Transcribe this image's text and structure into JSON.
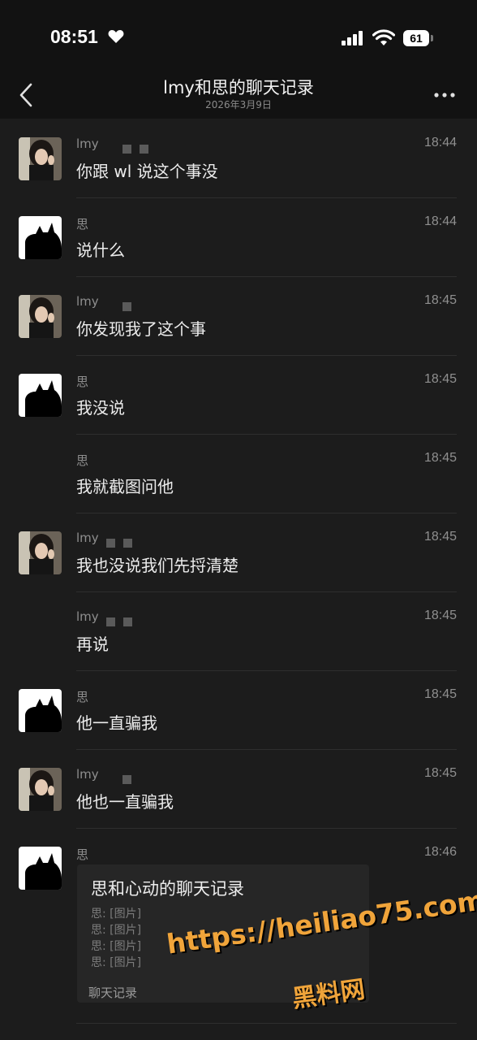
{
  "status_bar": {
    "time": "08:51",
    "battery": "61"
  },
  "nav": {
    "title": "lmy和思的聊天记录",
    "subtitle": "2026年3月9日"
  },
  "messages": [
    {
      "sender": "lmy",
      "time": "18:44",
      "text": "你跟 wl 说这个事没",
      "avatar": "girl"
    },
    {
      "sender": "思",
      "time": "18:44",
      "text": "说什么",
      "avatar": "cat"
    },
    {
      "sender": "lmy",
      "time": "18:45",
      "text": "你发现我了这个事",
      "avatar": "girl"
    },
    {
      "sender": "思",
      "time": "18:45",
      "text": "我没说",
      "avatar": "cat"
    },
    {
      "sender": "思",
      "time": "18:45",
      "text": "我就截图问他",
      "avatar": "none"
    },
    {
      "sender": "lmy",
      "time": "18:45",
      "text": "我也没说我们先捋清楚",
      "avatar": "girl"
    },
    {
      "sender": "lmy",
      "time": "18:45",
      "text": "再说",
      "avatar": "none"
    },
    {
      "sender": "思",
      "time": "18:45",
      "text": "他一直骗我",
      "avatar": "cat"
    },
    {
      "sender": "lmy",
      "time": "18:45",
      "text": "他也一直骗我",
      "avatar": "girl"
    },
    {
      "sender": "思",
      "time": "18:46",
      "text": "",
      "avatar": "cat"
    }
  ],
  "record_card": {
    "title": "思和心动的聊天记录",
    "lines": [
      "思: [图片]",
      "思: [图片]",
      "思: [图片]",
      "思: [图片]"
    ],
    "footer": "聊天记录"
  },
  "watermark": {
    "url": "https://heiliao75.com",
    "name": "黑料网"
  }
}
